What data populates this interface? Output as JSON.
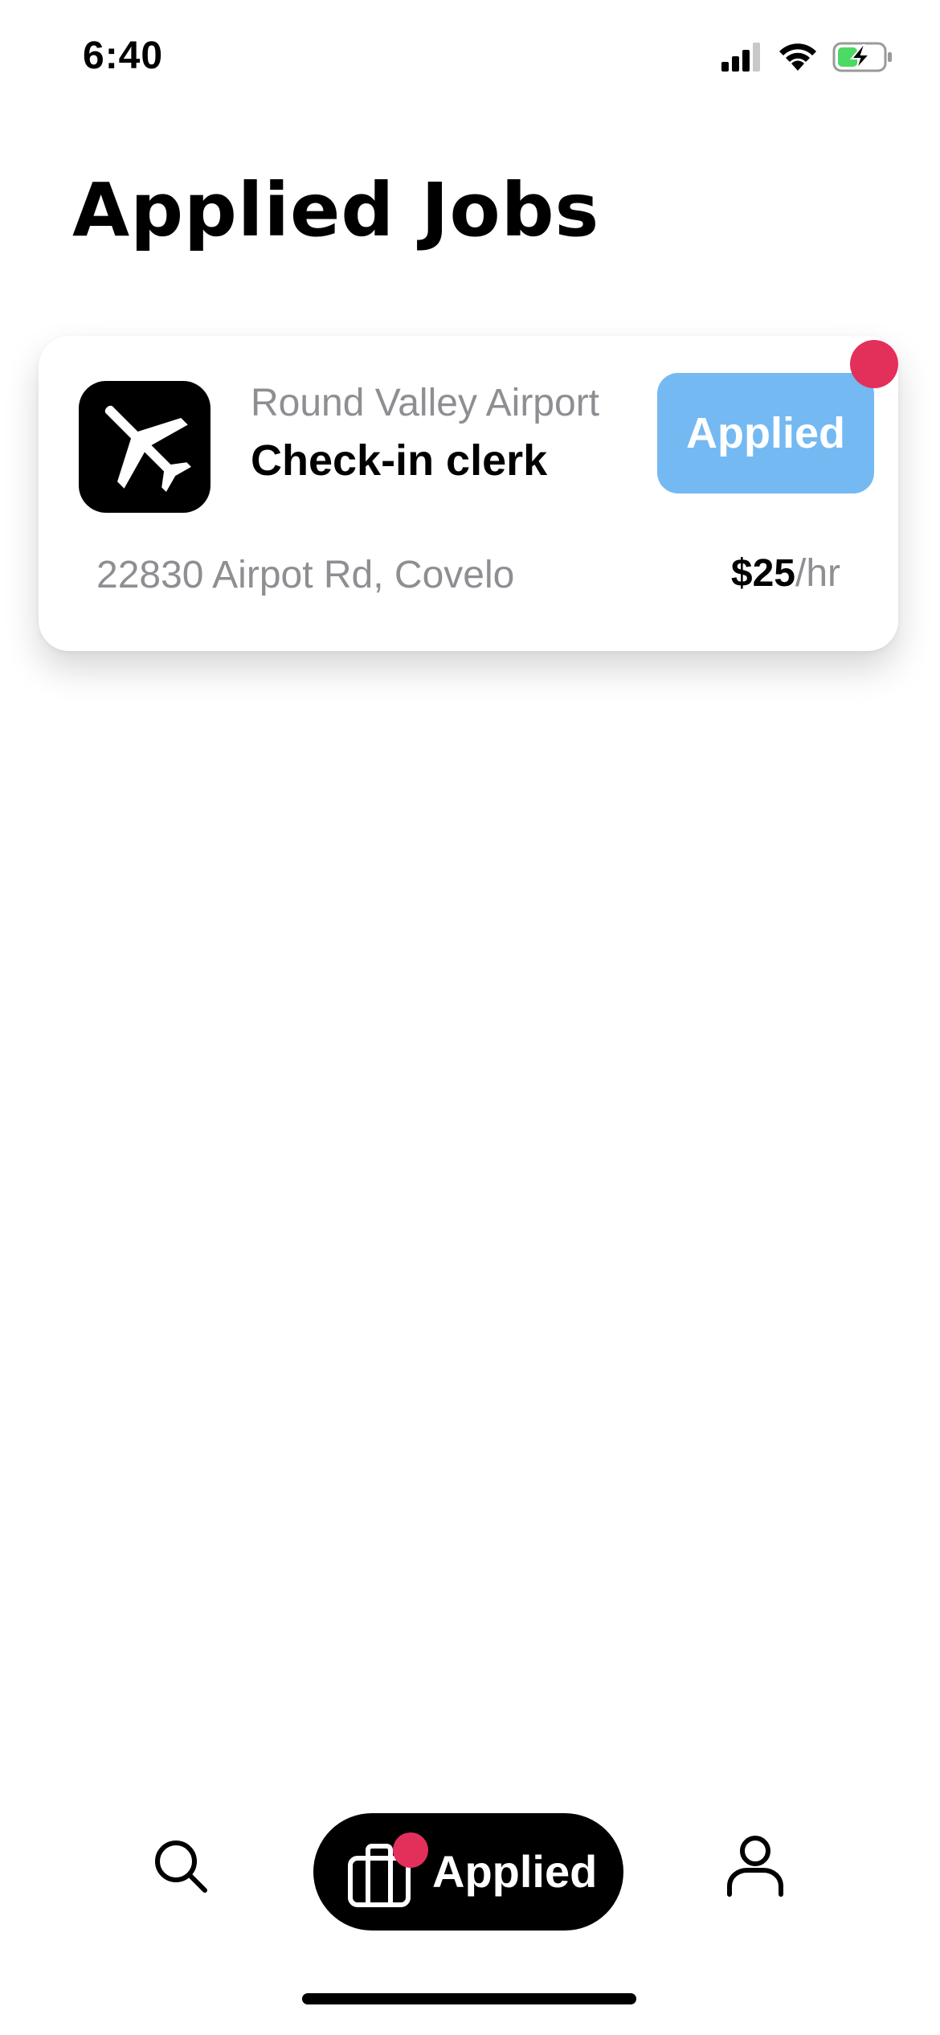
{
  "status_bar": {
    "time": "6:40",
    "icons": [
      "cellular-signal-icon",
      "wifi-icon",
      "battery-charging-icon"
    ],
    "battery_color": "#4cd964"
  },
  "header": {
    "title": "Applied Jobs"
  },
  "jobs": [
    {
      "company": "Round Valley Airport",
      "title": "Check-in clerk",
      "logo_icon": "airplane-icon",
      "status_label": "Applied",
      "status_color": "#74b9f2",
      "has_notification": true,
      "address": "22830 Airpot Rd, Covelo",
      "pay_amount": "$25",
      "pay_unit": "/hr"
    }
  ],
  "tab_bar": {
    "items": [
      {
        "icon": "search-icon",
        "label": "",
        "active": false
      },
      {
        "icon": "briefcase-icon",
        "label": "Applied",
        "active": true,
        "has_notification": true
      },
      {
        "icon": "profile-icon",
        "label": "",
        "active": false
      }
    ]
  },
  "colors": {
    "badge": "#e3305a",
    "secondary_text": "#8e8e93"
  }
}
